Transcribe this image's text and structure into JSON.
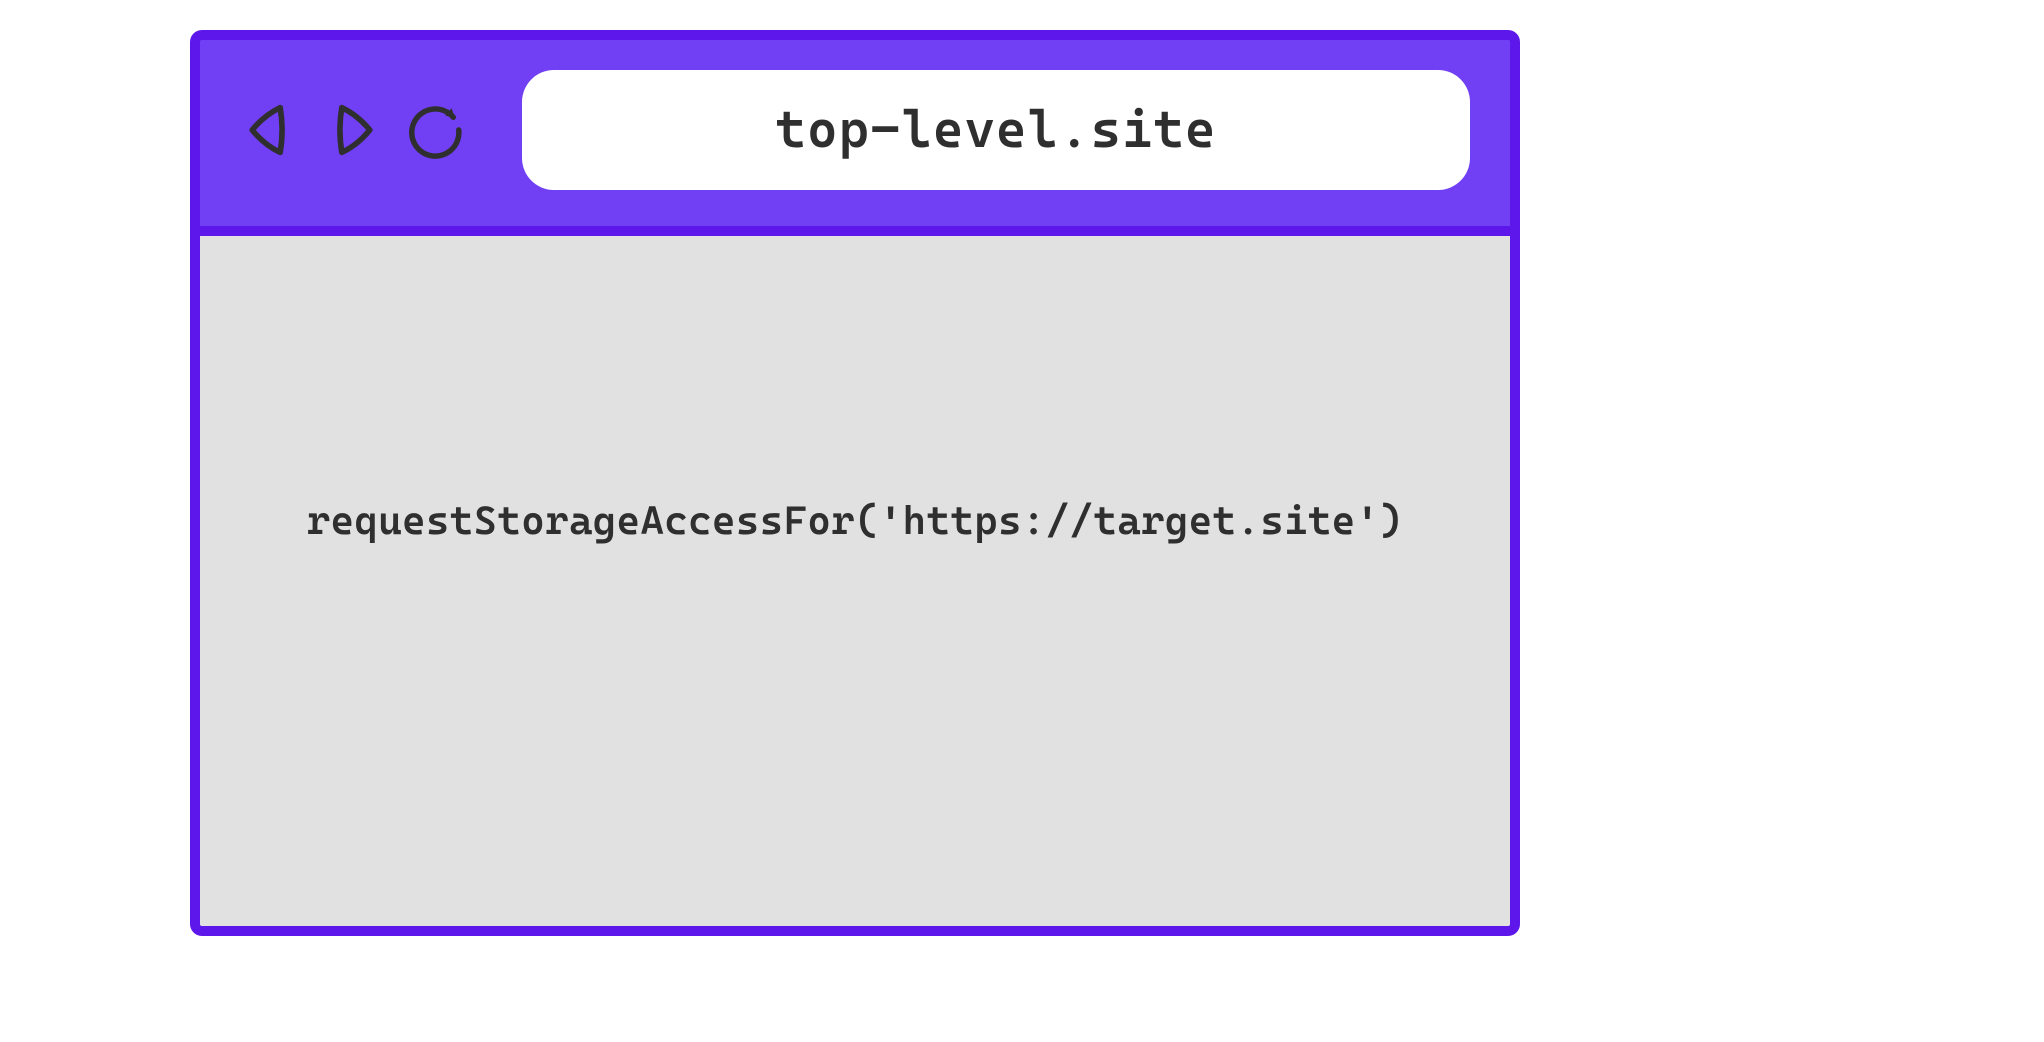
{
  "browser": {
    "url": "top-level.site",
    "code": "requestStorageAccessFor('https://target.site')"
  },
  "colors": {
    "window_border": "#5e17eb",
    "toolbar_bg": "#713ff4",
    "viewport_bg": "#e1e1e1",
    "text": "#2f2f2f",
    "address_bg": "#ffffff"
  }
}
